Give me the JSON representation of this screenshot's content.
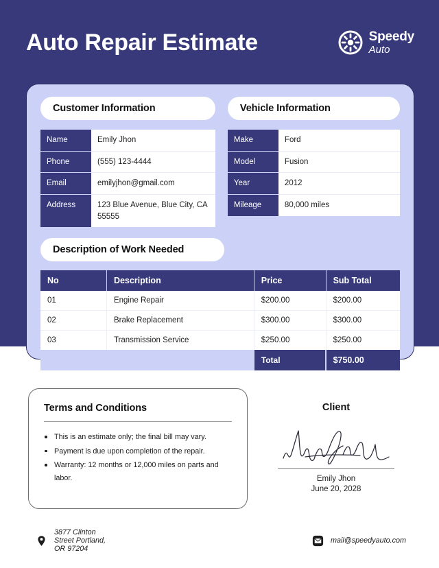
{
  "header": {
    "title": "Auto Repair Estimate",
    "brand_name": "Speedy",
    "brand_sub": "Auto",
    "brand_icon": "wheel-icon",
    "background_color": "#37397a"
  },
  "customer": {
    "section_title": "Customer Information",
    "rows": [
      {
        "key": "Name",
        "value": "Emily Jhon"
      },
      {
        "key": "Phone",
        "value": "(555) 123-4444"
      },
      {
        "key": "Email",
        "value": "emilyjhon@gmail.com"
      },
      {
        "key": "Address",
        "value": "123 Blue Avenue, Blue City, CA 55555"
      }
    ]
  },
  "vehicle": {
    "section_title": "Vehicle Information",
    "rows": [
      {
        "key": "Make",
        "value": "Ford"
      },
      {
        "key": "Model",
        "value": "Fusion"
      },
      {
        "key": "Year",
        "value": "2012"
      },
      {
        "key": "Mileage",
        "value": "80,000 miles"
      }
    ]
  },
  "work": {
    "section_title": "Description of Work Needed",
    "columns": [
      "No",
      "Description",
      "Price",
      "Sub Total"
    ],
    "rows": [
      {
        "no": "01",
        "description": "Engine Repair",
        "price": "$200.00",
        "subtotal": "$200.00"
      },
      {
        "no": "02",
        "description": "Brake Replacement",
        "price": "$300.00",
        "subtotal": "$300.00"
      },
      {
        "no": "03",
        "description": "Transmission Service",
        "price": "$250.00",
        "subtotal": "$250.00"
      }
    ],
    "total_label": "Total",
    "total_value": "$750.00"
  },
  "terms": {
    "title": "Terms and Conditions",
    "items": [
      "This is an estimate only; the final bill may vary.",
      "Payment is due upon completion of the repair.",
      "Warranty: 12 months or 12,000 miles on parts and labor."
    ]
  },
  "client": {
    "title": "Client",
    "signature_icon": "handwritten-signature",
    "name": "Emily Jhon",
    "date": "June 20, 2028"
  },
  "footer": {
    "address_icon": "location-pin-icon",
    "address": "3877 Clinton Street Portland, OR 97204",
    "email_icon": "envelope-icon",
    "email": "mail@speedyauto.com"
  },
  "colors": {
    "navy": "#37397a",
    "lavender": "#ccd1f7",
    "card_border": "#2b2d63",
    "white": "#ffffff"
  }
}
